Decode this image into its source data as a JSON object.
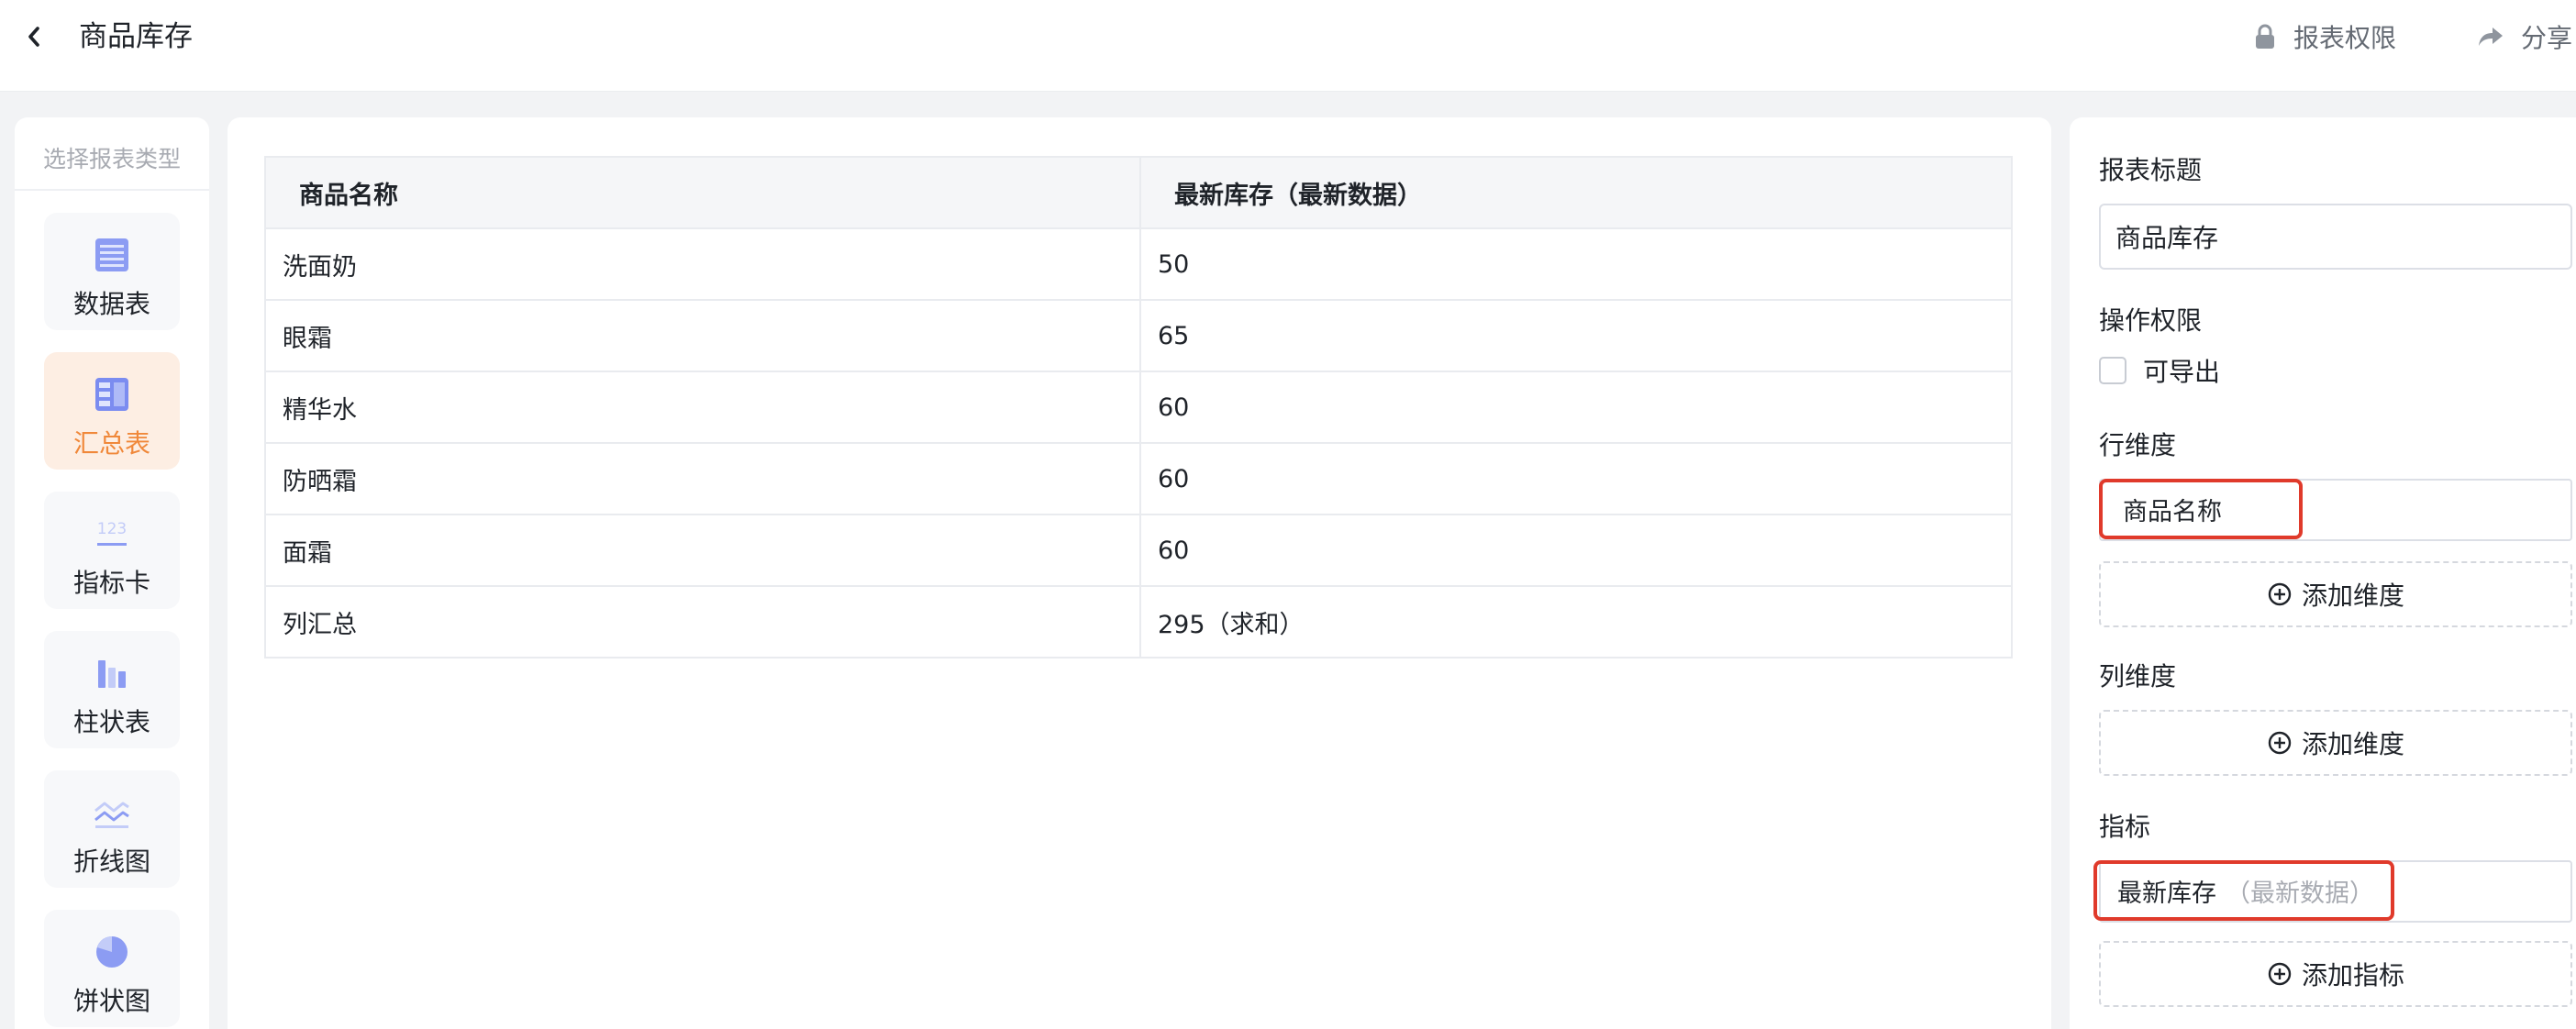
{
  "header": {
    "title": "商品库存",
    "permission_label": "报表权限",
    "share_label": "分享"
  },
  "sidebar": {
    "heading": "选择报表类型",
    "items": [
      {
        "label": "数据表",
        "icon": "table-icon"
      },
      {
        "label": "汇总表",
        "icon": "summary-table-icon",
        "active": true
      },
      {
        "label": "指标卡",
        "icon": "metric-card-icon"
      },
      {
        "label": "柱状表",
        "icon": "bar-chart-icon"
      },
      {
        "label": "折线图",
        "icon": "line-chart-icon"
      },
      {
        "label": "饼状图",
        "icon": "pie-chart-icon"
      }
    ]
  },
  "table": {
    "columns": [
      "商品名称",
      "最新库存（最新数据）"
    ],
    "rows": [
      [
        "洗面奶",
        "50"
      ],
      [
        "眼霜",
        "65"
      ],
      [
        "精华水",
        "60"
      ],
      [
        "防晒霜",
        "60"
      ],
      [
        "面霜",
        "60"
      ],
      [
        "列汇总",
        "295（求和）"
      ]
    ]
  },
  "config": {
    "title_label": "报表标题",
    "title_value": "商品库存",
    "permission_label": "操作权限",
    "export_label": "可导出",
    "row_dim_label": "行维度",
    "row_dim_value": "商品名称",
    "add_dim_label": "添加维度",
    "col_dim_label": "列维度",
    "add_col_dim_label": "添加维度",
    "metric_label": "指标",
    "metric_name": "最新库存",
    "metric_sub": "（最新数据）",
    "add_metric_label": "添加指标"
  },
  "colors": {
    "accent": "#f0883a",
    "active_bg": "#fdeee3",
    "highlight": "#e03a2b",
    "icon_blue": "#7b8cf0"
  }
}
